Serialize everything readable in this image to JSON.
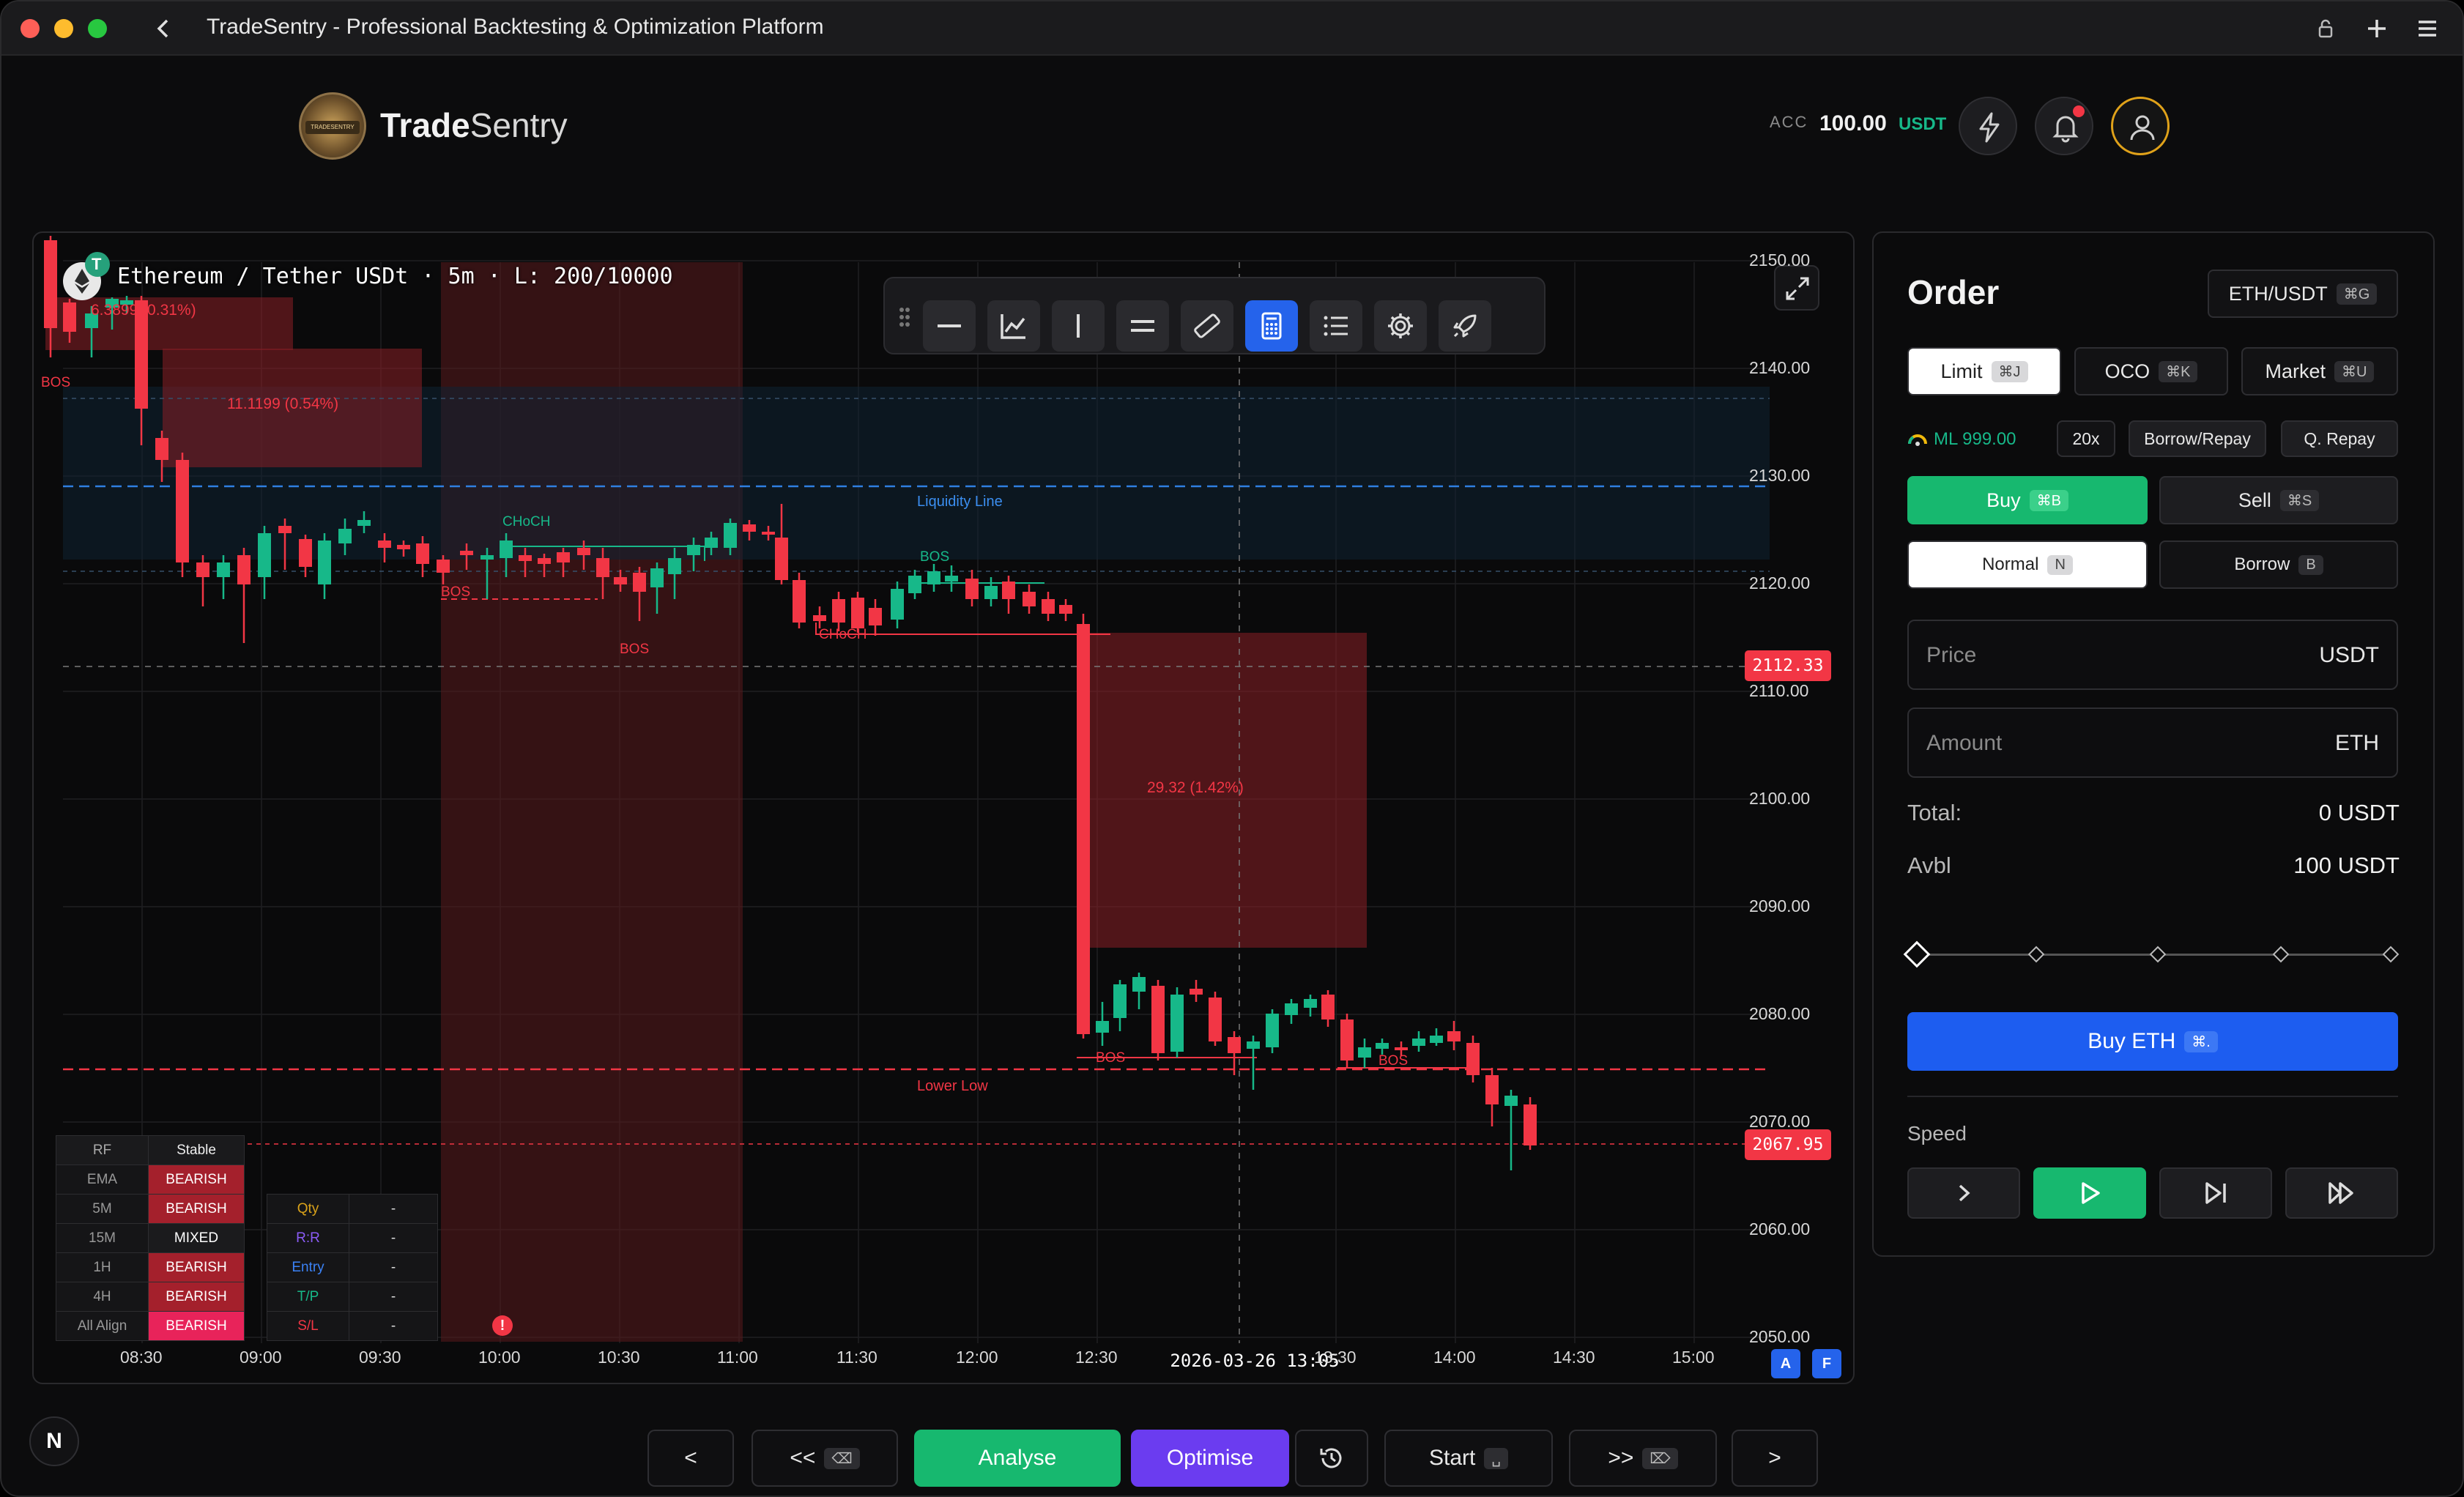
{
  "window": {
    "title": "TradeSentry - Professional Backtesting & Optimization Platform"
  },
  "brand": {
    "logo_bold": "Trade",
    "logo_rest": "Sentry",
    "seal_text": "TRADESENTRY"
  },
  "account": {
    "label": "ACC",
    "balance": "100.00",
    "currency": "USDT"
  },
  "chart": {
    "title": "Ethereum / Tether USDt · 5m · L: 200/10000",
    "price_labels": [
      "2150.00",
      "2140.00",
      "2130.00",
      "2120.00",
      "2110.00",
      "2100.00",
      "2090.00",
      "2080.00",
      "2070.00",
      "2060.00",
      "2050.00"
    ],
    "time_labels": [
      "08:30",
      "09:00",
      "09:30",
      "10:00",
      "10:30",
      "11:00",
      "11:30",
      "12:00",
      "12:30",
      "13:30",
      "14:00",
      "14:30",
      "15:00"
    ],
    "crosshair_time": "2026-03-26 13:05",
    "current_price": "2112.33",
    "last_price": "2067.95",
    "annotations": {
      "box1": "6.3899 (0.31%)",
      "box2": "11.1199 (0.54%)",
      "box3": "29.32 (1.42%)",
      "liquidity": "Liquidity Line",
      "lower_low": "Lower Low",
      "bos": "BOS",
      "choch": "CHoCH"
    },
    "badges": [
      "A",
      "F"
    ],
    "colors": {
      "bull": "#17b889",
      "bear": "#f23645",
      "liquidity": "#2f7fe0"
    }
  },
  "trend_table": {
    "header": [
      "RF",
      "Stable"
    ],
    "rows": [
      [
        "EMA",
        "BEARISH"
      ],
      [
        "5M",
        "BEARISH"
      ],
      [
        "15M",
        "MIXED"
      ],
      [
        "1H",
        "BEARISH"
      ],
      [
        "4H",
        "BEARISH"
      ],
      [
        "All Align",
        "BEARISH"
      ]
    ]
  },
  "trade_table": {
    "rows": [
      [
        "Qty",
        "-"
      ],
      [
        "R:R",
        "-"
      ],
      [
        "Entry",
        "-"
      ],
      [
        "T/P",
        "-"
      ],
      [
        "S/L",
        "-"
      ]
    ]
  },
  "order": {
    "title": "Order",
    "pair": "ETH/USDT",
    "pair_kbd": "⌘G",
    "types": [
      {
        "label": "Limit",
        "kbd": "⌘J"
      },
      {
        "label": "OCO",
        "kbd": "⌘K"
      },
      {
        "label": "Market",
        "kbd": "⌘U"
      }
    ],
    "ml": "ML 999.00",
    "leverage": "20x",
    "borrow_repay": "Borrow/Repay",
    "q_repay": "Q. Repay",
    "buy": {
      "label": "Buy",
      "kbd": "⌘B"
    },
    "sell": {
      "label": "Sell",
      "kbd": "⌘S"
    },
    "normal": {
      "label": "Normal",
      "kbd": "N"
    },
    "borrow": {
      "label": "Borrow",
      "kbd": "B"
    },
    "price": {
      "placeholder": "Price",
      "unit": "USDT"
    },
    "amount": {
      "placeholder": "Amount",
      "unit": "ETH"
    },
    "total_label": "Total:",
    "total_value": "0 USDT",
    "avbl_label": "Avbl",
    "avbl_value": "100 USDT",
    "slider_level": 0,
    "submit": {
      "label": "Buy ETH",
      "kbd": "⌘."
    },
    "speed_label": "Speed"
  },
  "bottom_bar": {
    "prev": "<",
    "back": "<<",
    "analyse": "Analyse",
    "optimise": "Optimise",
    "start": "Start",
    "fwd": ">>",
    "next": ">"
  },
  "avatar_initial": "N"
}
